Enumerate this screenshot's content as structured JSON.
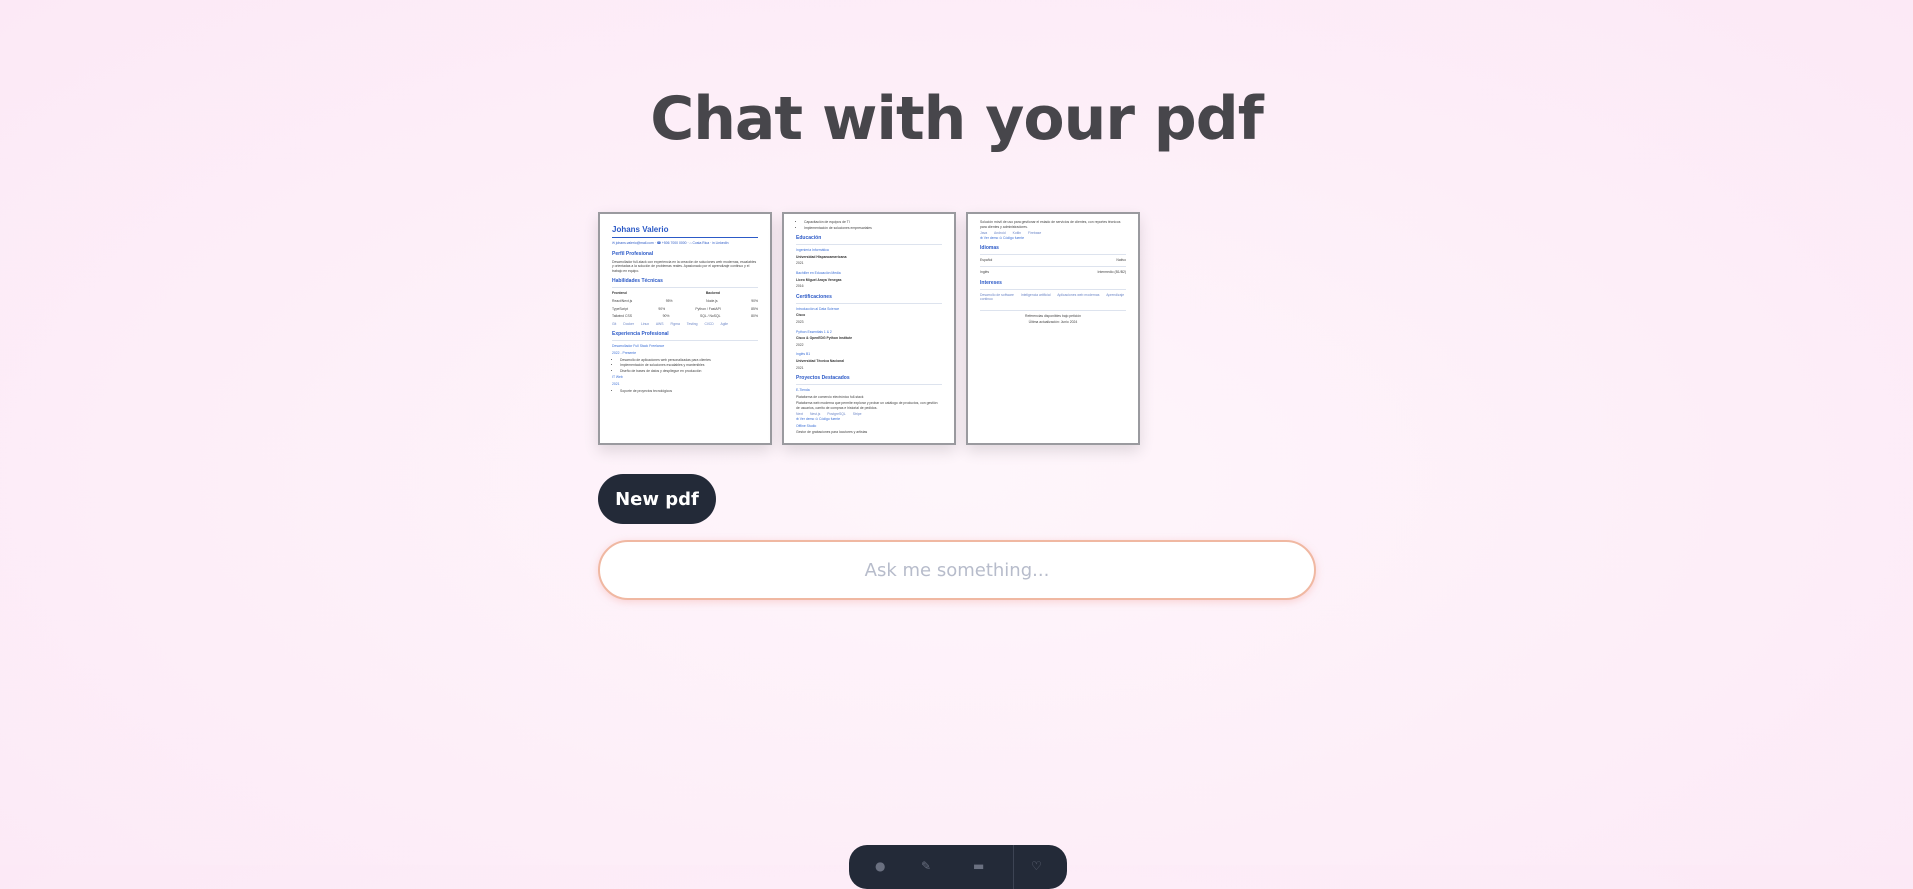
{
  "header": {
    "title": "Chat with your pdf"
  },
  "pages": [
    {
      "name": "Johans Valerio",
      "contact": "✉ johans.valerio@mail.com · ☎ +506 7000 0000 · ⌂ Costa Rica · in LinkedIn",
      "sections": {
        "profile": {
          "title": "Perfil Profesional",
          "text": "Desarrollador full-stack con experiencia en la creación de soluciones web modernas, escalables y orientadas a la solución de problemas reales. Apasionado por el aprendizaje continuo y el trabajo en equipo."
        },
        "skills": {
          "title": "Habilidades Técnicas",
          "frontend_label": "Frontend",
          "backend_label": "Backend",
          "rows": [
            [
              "React/Next.js",
              "95%",
              "Node.js",
              "90%"
            ],
            [
              "TypeScript",
              "90%",
              "Python / FastAPI",
              "85%"
            ],
            [
              "Tailwind CSS",
              "90%",
              "SQL / NoSQL",
              "80%"
            ]
          ],
          "chips": [
            "Git",
            "Docker",
            "Linux",
            "AWS",
            "Figma",
            "Testing",
            "CI/CD",
            "Agile"
          ]
        },
        "experience": {
          "title": "Experiencia Profesional",
          "job1": "Desarrollador Full Stack Freelance",
          "job1_date": "2022 - Presente",
          "job1_bullets": [
            "Desarrollo de aplicaciones web personalizadas para clientes",
            "Implementación de soluciones escalables y mantenibles",
            "Diseño de bases de datos y despliegue en producción"
          ],
          "job2": "IT Web",
          "job2_date": "2021",
          "job2_bullets": [
            "Soporte de proyectos tecnológicos"
          ]
        }
      }
    },
    {
      "top_bullets": [
        "Capacitación de equipos de TI",
        "Implementación de soluciones empresariales"
      ],
      "education": {
        "title": "Educación",
        "items": [
          {
            "degree": "Ingeniería Informática",
            "school": "Universidad Hispanoamericana",
            "year": "2021"
          },
          {
            "degree": "Bachiller en Educación Media",
            "school": "Liceo Miguel Araya Venegas",
            "year": "2016"
          }
        ]
      },
      "certs": {
        "title": "Certificaciones",
        "items": [
          {
            "name": "Introducción al Data Science",
            "org": "Cisco",
            "year": "2023"
          },
          {
            "name": "Python Essentials 1 & 2",
            "org": "Cisco & OpenEDG Python Institute",
            "year": "2022"
          },
          {
            "name": "Inglés B1",
            "org": "Universidad Técnica Nacional",
            "year": "2021"
          }
        ]
      },
      "projects": {
        "title": "Proyectos Destacados",
        "p1": "E-Tienda",
        "p1_sub": "Plataforma de comercio electrónico full-stack",
        "p1_text": "Plataforma web moderna que permite explorar y probar un catálogo de productos, con gestión de usuarios, carrito de compras e historial de pedidos.",
        "p1_chips": [
          "Next",
          "Nest.js",
          "PostgreSQL",
          "Stripe"
        ],
        "p1_links": [
          "⊕ Ver demo",
          "⊙ Código fuente"
        ],
        "p2": "Offline Studio",
        "p2_sub": "Gestor de grabaciones para locutores y artistas"
      }
    },
    {
      "top_text": "Solución móvil de uso para gestionar el estado de servicios de clientes, con reportes técnicos para clientes y administradores.",
      "top_chips": [
        "Java",
        "Android",
        "Kotlin",
        "Firebase"
      ],
      "top_links": [
        "⊕ Ver demo",
        "⊙ Código fuente"
      ],
      "languages": {
        "title": "Idiomas",
        "rows": [
          [
            "Español",
            "Nativo"
          ],
          [
            "Inglés",
            "Intermedio (B1/B2)"
          ]
        ]
      },
      "interests": {
        "title": "Intereses",
        "chips": [
          "Desarrollo de software",
          "Inteligencia artificial",
          "Aplicaciones web modernas",
          "Aprendizaje continuo"
        ]
      },
      "footer1": "Referencias disponibles bajo petición",
      "footer2": "Última actualización: Junio 2024"
    }
  ],
  "actions": {
    "new_pdf_label": "New pdf"
  },
  "chat": {
    "placeholder": "Ask me something..."
  },
  "dock": {
    "icons": [
      "microphone-icon",
      "pen-icon",
      "minus-icon",
      "heart-icon"
    ]
  }
}
